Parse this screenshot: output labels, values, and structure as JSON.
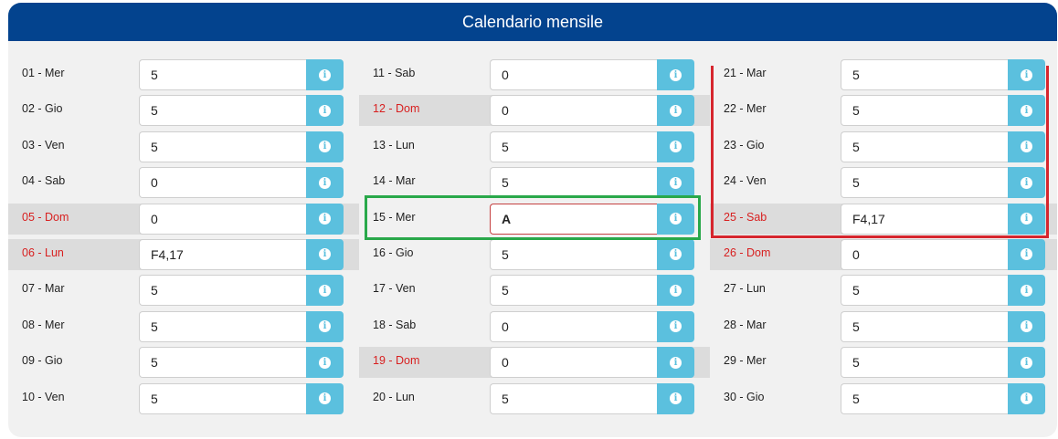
{
  "panel": {
    "title": "Calendario mensile"
  },
  "colors": {
    "header": "#03438e",
    "info_button": "#5bc0de",
    "holiday_text": "#d82020",
    "green_box": "#29a84a",
    "red_box": "#d6262e"
  },
  "info_icon": "info-circle-icon",
  "days": [
    {
      "label": "01 - Mer",
      "value": "5",
      "holiday": false
    },
    {
      "label": "02 - Gio",
      "value": "5",
      "holiday": false
    },
    {
      "label": "03 - Ven",
      "value": "5",
      "holiday": false
    },
    {
      "label": "04 - Sab",
      "value": "0",
      "holiday": false
    },
    {
      "label": "05 - Dom",
      "value": "0",
      "holiday": true
    },
    {
      "label": "06 - Lun",
      "value": "F4,17",
      "holiday": true
    },
    {
      "label": "07 - Mar",
      "value": "5",
      "holiday": false
    },
    {
      "label": "08 - Mer",
      "value": "5",
      "holiday": false
    },
    {
      "label": "09 - Gio",
      "value": "5",
      "holiday": false
    },
    {
      "label": "10 - Ven",
      "value": "5",
      "holiday": false
    },
    {
      "label": "11 - Sab",
      "value": "0",
      "holiday": false
    },
    {
      "label": "12 - Dom",
      "value": "0",
      "holiday": true
    },
    {
      "label": "13 - Lun",
      "value": "5",
      "holiday": false
    },
    {
      "label": "14 - Mar",
      "value": "5",
      "holiday": false
    },
    {
      "label": "15 - Mer",
      "value": "A",
      "holiday": false,
      "active": true
    },
    {
      "label": "16 - Gio",
      "value": "5",
      "holiday": false
    },
    {
      "label": "17 - Ven",
      "value": "5",
      "holiday": false
    },
    {
      "label": "18 - Sab",
      "value": "0",
      "holiday": false
    },
    {
      "label": "19 - Dom",
      "value": "0",
      "holiday": true
    },
    {
      "label": "20 - Lun",
      "value": "5",
      "holiday": false
    },
    {
      "label": "21 - Mar",
      "value": "5",
      "holiday": false
    },
    {
      "label": "22 - Mer",
      "value": "5",
      "holiday": false
    },
    {
      "label": "23 - Gio",
      "value": "5",
      "holiday": false
    },
    {
      "label": "24 - Ven",
      "value": "5",
      "holiday": false
    },
    {
      "label": "25 - Sab",
      "value": "F4,17",
      "holiday": true
    },
    {
      "label": "26 - Dom",
      "value": "0",
      "holiday": true
    },
    {
      "label": "27 - Lun",
      "value": "5",
      "holiday": false
    },
    {
      "label": "28 - Mar",
      "value": "5",
      "holiday": false
    },
    {
      "label": "29 - Mer",
      "value": "5",
      "holiday": false
    },
    {
      "label": "30 - Gio",
      "value": "5",
      "holiday": false
    }
  ]
}
